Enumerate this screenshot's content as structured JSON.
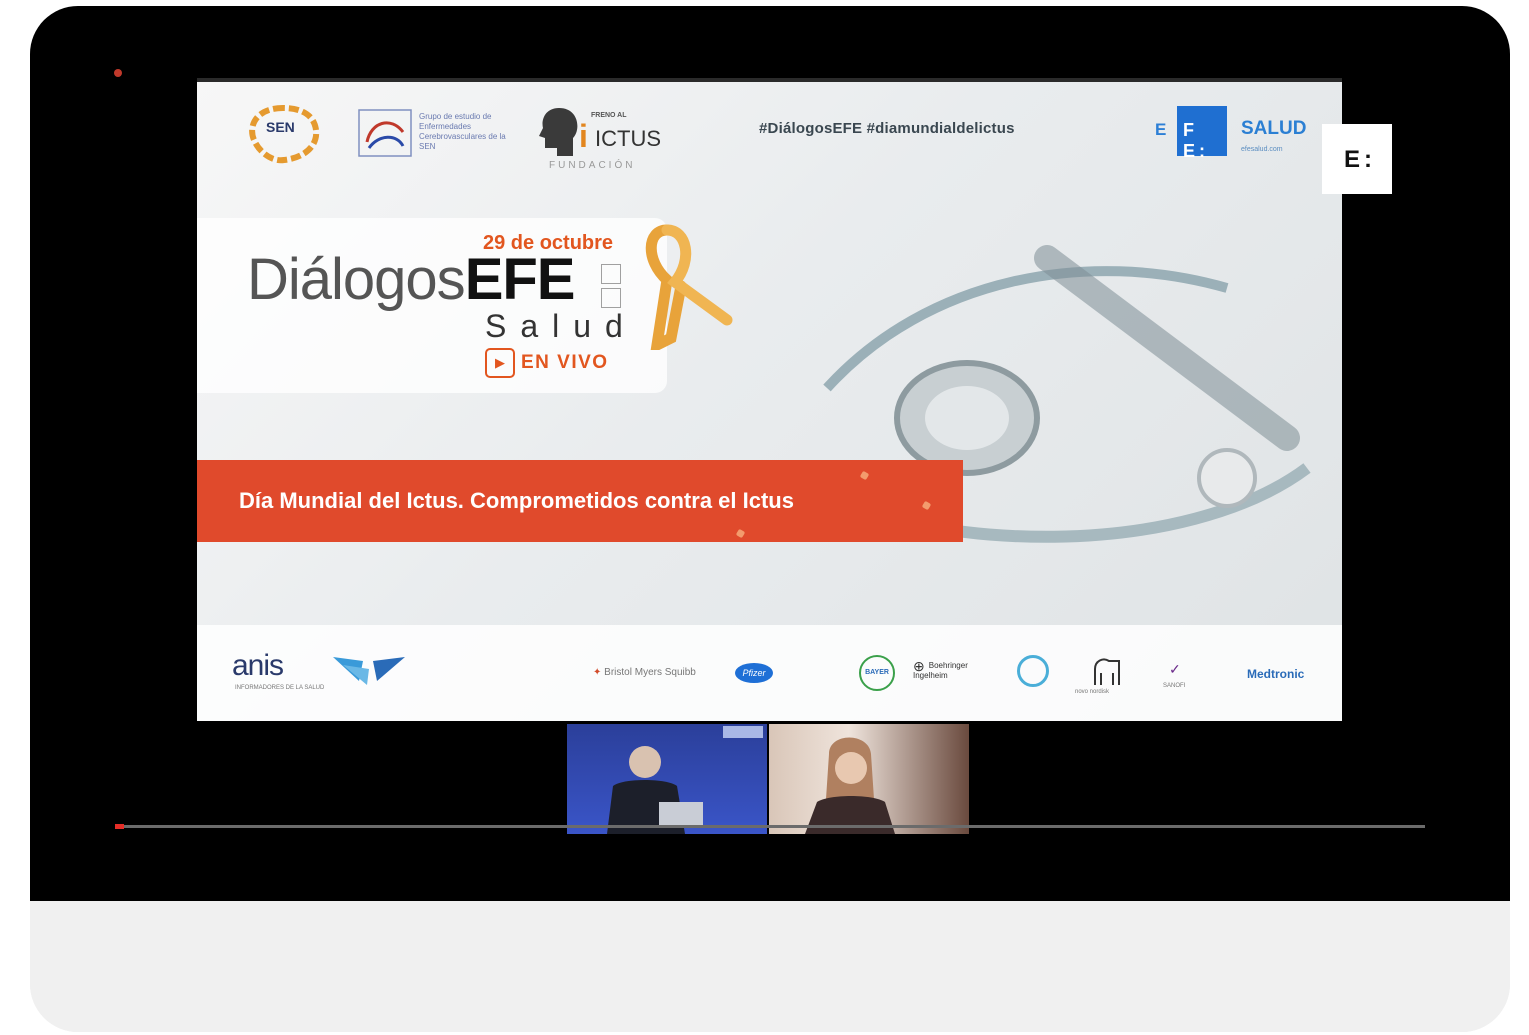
{
  "video": {
    "progress_percent": 0.7,
    "slide": {
      "logos": {
        "sen": "SEN",
        "grupo_estudio": "Grupo de estudio de Enfermedades Cerebrovasculares de la SEN",
        "freno_al": "FRENO AL",
        "ictus": "ICTUS",
        "fundacion": "FUNDACIÓN",
        "efe": "E F E",
        "efe_inner": "F E:",
        "salud": "SALUD"
      },
      "hashtags": "#DiálogosEFE  #diamundialdelictus",
      "watermark": "E:",
      "date": "29 de octubre",
      "title_light": "Diálogos",
      "title_bold": "EFE",
      "subtitle": "Salud",
      "live_label": "EN VIVO",
      "banner": "Día Mundial del Ictus. Comprometidos contra el Ictus",
      "sponsors": {
        "anis": "anis",
        "bms": "Bristol Myers Squibb",
        "pfizer": "Pfizer",
        "bayer": "BAYER",
        "boehringer": "Boehringer Ingelheim",
        "novo": "novo nordisk",
        "sanofi": "SANOFI",
        "medtronic": "Medtronic"
      }
    }
  },
  "colors": {
    "accent_orange": "#e04a2c",
    "efe_blue": "#1f6fd1",
    "progress_red": "#e52d27"
  }
}
